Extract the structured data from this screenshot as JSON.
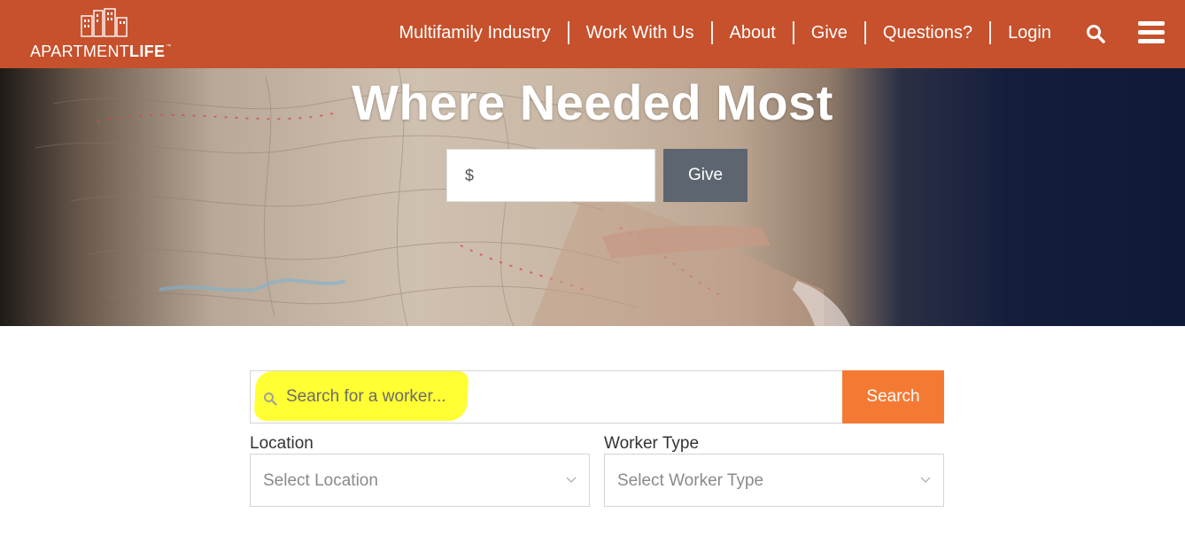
{
  "brand": {
    "logo_text_a": "APARTMENT",
    "logo_text_b": "LIFE",
    "trademark": "™"
  },
  "nav": {
    "items": [
      {
        "label": "Multifamily Industry"
      },
      {
        "label": "Work With Us"
      },
      {
        "label": "About"
      },
      {
        "label": "Give"
      },
      {
        "label": "Questions?"
      },
      {
        "label": "Login"
      }
    ],
    "search_icon": "search-icon",
    "menu_icon": "hamburger-menu-icon"
  },
  "hero": {
    "title": "Where Needed Most",
    "amount_prefix": "$",
    "give_label": "Give"
  },
  "search": {
    "placeholder": "Search for a worker...",
    "button_label": "Search"
  },
  "filters": {
    "location": {
      "label": "Location",
      "value": "Select Location"
    },
    "worker_type": {
      "label": "Worker Type",
      "value": "Select Worker Type"
    }
  },
  "colors": {
    "header": "#c6512c",
    "search_button": "#f47a34",
    "give_button": "#5d6670",
    "highlight": "#ffff33"
  }
}
